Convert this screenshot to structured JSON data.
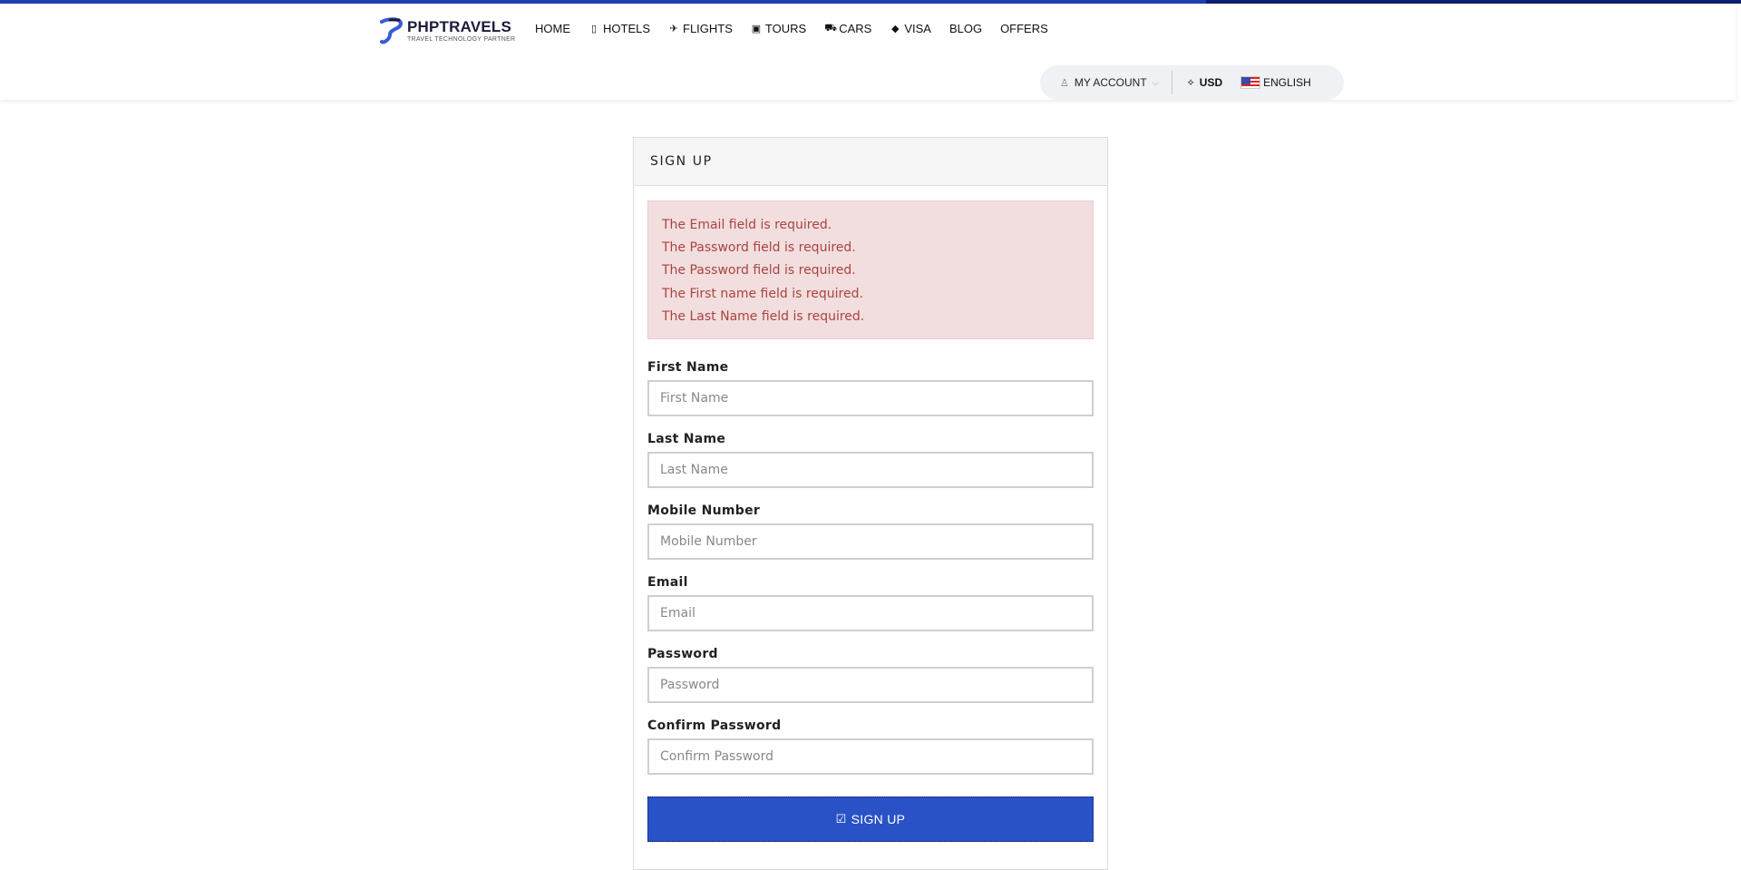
{
  "brand": {
    "name": "PHPTRAVELS",
    "tagline": "TRAVEL TECHNOLOGY PARTNER",
    "accent": "#1f3fb0"
  },
  "nav": {
    "items": [
      {
        "label": "HOME",
        "icon": ""
      },
      {
        "label": "HOTELS",
        "icon": "building-icon"
      },
      {
        "label": "FLIGHTS",
        "icon": "plane-icon"
      },
      {
        "label": "TOURS",
        "icon": "suitcase-icon"
      },
      {
        "label": "CARS",
        "icon": "car-icon"
      },
      {
        "label": "VISA",
        "icon": "tag-icon"
      },
      {
        "label": "BLOG",
        "icon": ""
      },
      {
        "label": "OFFERS",
        "icon": ""
      }
    ]
  },
  "account_bar": {
    "account_label": "MY ACCOUNT",
    "currency": "USD",
    "language": "ENGLISH"
  },
  "panel": {
    "title": "SIGN UP"
  },
  "errors": [
    "The Email field is required.",
    "The Password field is required.",
    "The Password field is required.",
    "The First name field is required.",
    "The Last Name field is required."
  ],
  "form": {
    "first_name": {
      "label": "First Name",
      "placeholder": "First Name",
      "value": ""
    },
    "last_name": {
      "label": "Last Name",
      "placeholder": "Last Name",
      "value": ""
    },
    "mobile": {
      "label": "Mobile Number",
      "placeholder": "Mobile Number",
      "value": ""
    },
    "email": {
      "label": "Email",
      "placeholder": "Email",
      "value": ""
    },
    "password": {
      "label": "Password",
      "placeholder": "Password",
      "value": ""
    },
    "confirm_password": {
      "label": "Confirm Password",
      "placeholder": "Confirm Password",
      "value": ""
    },
    "submit_label": "SIGN UP",
    "submit_color": "#2a52c7"
  }
}
